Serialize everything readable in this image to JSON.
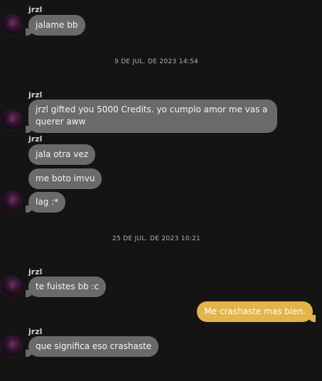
{
  "messages": [
    {
      "sender": "jrzl",
      "text": "jalame bb"
    },
    {
      "divider": "9 DE JUL. DE 2023 14:54"
    },
    {
      "sender": "jrzl",
      "text": "jrzl gifted you 5000 Credits. yo cumplo amor me vas a querer aww"
    },
    {
      "sender": "jrzl",
      "text": "jala otra vez"
    },
    {
      "text": "me boto imvu"
    },
    {
      "text": "lag :*"
    },
    {
      "divider": "25 DE JUL. DE 2023 10:21"
    },
    {
      "sender": "jrzl",
      "text": "te fuistes bb :c"
    },
    {
      "mine": true,
      "text": "Me crashaste mas bien."
    },
    {
      "sender": "jrzl",
      "text": "que significa eso crashaste"
    }
  ],
  "colors": {
    "background": "#141414",
    "incoming_bubble": "#6a6a6a",
    "outgoing_bubble": "#e3b449"
  }
}
